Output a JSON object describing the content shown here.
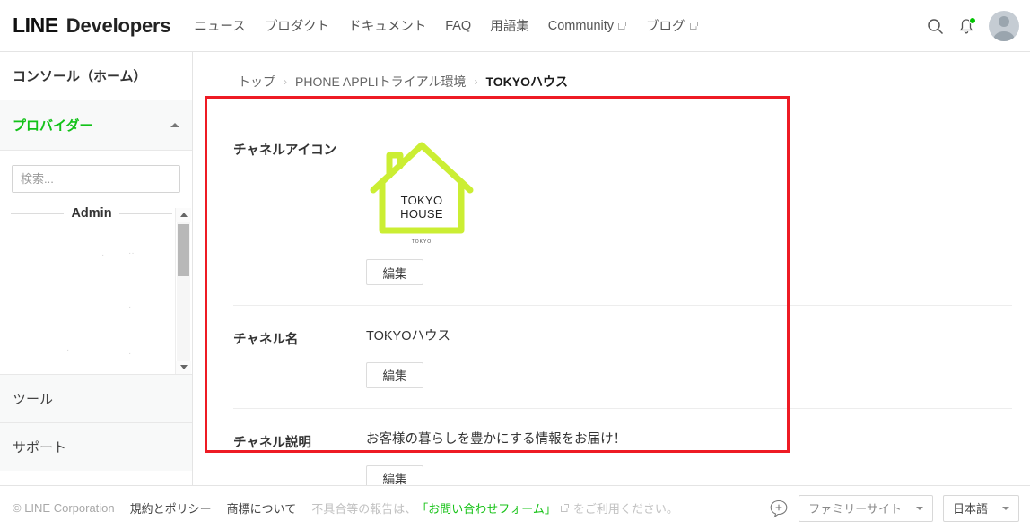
{
  "header": {
    "logo_line": "LINE",
    "logo_dev": "Developers",
    "nav": [
      {
        "label": "ニュース",
        "external": false
      },
      {
        "label": "プロダクト",
        "external": false
      },
      {
        "label": "ドキュメント",
        "external": false
      },
      {
        "label": "FAQ",
        "external": false
      },
      {
        "label": "用語集",
        "external": false
      },
      {
        "label": "Community",
        "external": true
      },
      {
        "label": "ブログ",
        "external": true
      }
    ],
    "search_icon": "search-icon",
    "notification_icon": "bell-icon",
    "notification_badge_color": "#00c300",
    "avatar_icon": "user-avatar"
  },
  "sidebar": {
    "home_label": "コンソール（ホーム）",
    "provider_label": "プロバイダー",
    "provider_color": "#12c218",
    "provider_chevron": "chevron-up-icon",
    "search_placeholder": "検索...",
    "search_value": "",
    "group_label": "Admin",
    "tool_label": "ツール",
    "support_label": "サポート"
  },
  "breadcrumb": {
    "items": [
      {
        "label": "トップ",
        "current": false
      },
      {
        "label": "PHONE APPLIトライアル環境",
        "current": false
      },
      {
        "label": "TOKYOハウス",
        "current": true
      }
    ],
    "separator": "›"
  },
  "channel": {
    "icon_row": {
      "label": "チャネルアイコン",
      "logo_text_line1": "TOKYO",
      "logo_text_line2": "HOUSE",
      "logo_caption": "TOKYO",
      "logo_color": "#cbee33",
      "edit_label": "編集"
    },
    "name_row": {
      "label": "チャネル名",
      "value": "TOKYOハウス",
      "edit_label": "編集"
    },
    "desc_row": {
      "label": "チャネル説明",
      "value": "お客様の暮らしを豊かにする情報をお届け！",
      "edit_label": "編集"
    }
  },
  "footer": {
    "copyright": "© LINE Corporation",
    "links": [
      {
        "label": "規約とポリシー"
      },
      {
        "label": "商標について"
      }
    ],
    "note_prefix": "不具合等の報告は、",
    "note_link": "「お問い合わせフォーム」",
    "note_suffix": "をご利用ください。",
    "note_link_color": "#19c319",
    "add_friend_icon": "speech-bubble-plus-icon",
    "family_site_label": "ファミリーサイト",
    "language_label": "日本語"
  },
  "annotation": {
    "type": "rectangle-highlight",
    "color": "#ee1b24"
  }
}
